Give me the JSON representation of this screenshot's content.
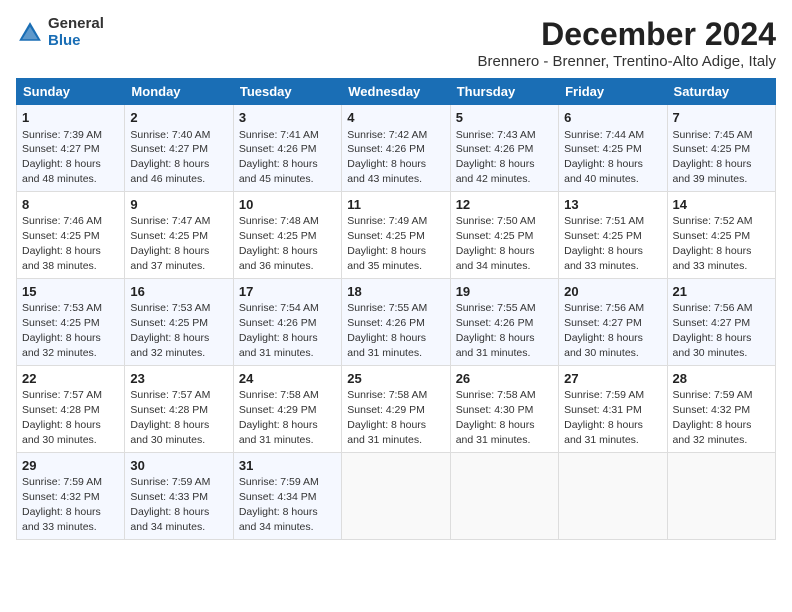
{
  "logo": {
    "general": "General",
    "blue": "Blue"
  },
  "title": "December 2024",
  "subtitle": "Brennero - Brenner, Trentino-Alto Adige, Italy",
  "days_of_week": [
    "Sunday",
    "Monday",
    "Tuesday",
    "Wednesday",
    "Thursday",
    "Friday",
    "Saturday"
  ],
  "weeks": [
    [
      {
        "day": "1",
        "sunrise": "7:39 AM",
        "sunset": "4:27 PM",
        "daylight": "8 hours and 48 minutes."
      },
      {
        "day": "2",
        "sunrise": "7:40 AM",
        "sunset": "4:27 PM",
        "daylight": "8 hours and 46 minutes."
      },
      {
        "day": "3",
        "sunrise": "7:41 AM",
        "sunset": "4:26 PM",
        "daylight": "8 hours and 45 minutes."
      },
      {
        "day": "4",
        "sunrise": "7:42 AM",
        "sunset": "4:26 PM",
        "daylight": "8 hours and 43 minutes."
      },
      {
        "day": "5",
        "sunrise": "7:43 AM",
        "sunset": "4:26 PM",
        "daylight": "8 hours and 42 minutes."
      },
      {
        "day": "6",
        "sunrise": "7:44 AM",
        "sunset": "4:25 PM",
        "daylight": "8 hours and 40 minutes."
      },
      {
        "day": "7",
        "sunrise": "7:45 AM",
        "sunset": "4:25 PM",
        "daylight": "8 hours and 39 minutes."
      }
    ],
    [
      {
        "day": "8",
        "sunrise": "7:46 AM",
        "sunset": "4:25 PM",
        "daylight": "8 hours and 38 minutes."
      },
      {
        "day": "9",
        "sunrise": "7:47 AM",
        "sunset": "4:25 PM",
        "daylight": "8 hours and 37 minutes."
      },
      {
        "day": "10",
        "sunrise": "7:48 AM",
        "sunset": "4:25 PM",
        "daylight": "8 hours and 36 minutes."
      },
      {
        "day": "11",
        "sunrise": "7:49 AM",
        "sunset": "4:25 PM",
        "daylight": "8 hours and 35 minutes."
      },
      {
        "day": "12",
        "sunrise": "7:50 AM",
        "sunset": "4:25 PM",
        "daylight": "8 hours and 34 minutes."
      },
      {
        "day": "13",
        "sunrise": "7:51 AM",
        "sunset": "4:25 PM",
        "daylight": "8 hours and 33 minutes."
      },
      {
        "day": "14",
        "sunrise": "7:52 AM",
        "sunset": "4:25 PM",
        "daylight": "8 hours and 33 minutes."
      }
    ],
    [
      {
        "day": "15",
        "sunrise": "7:53 AM",
        "sunset": "4:25 PM",
        "daylight": "8 hours and 32 minutes."
      },
      {
        "day": "16",
        "sunrise": "7:53 AM",
        "sunset": "4:25 PM",
        "daylight": "8 hours and 32 minutes."
      },
      {
        "day": "17",
        "sunrise": "7:54 AM",
        "sunset": "4:26 PM",
        "daylight": "8 hours and 31 minutes."
      },
      {
        "day": "18",
        "sunrise": "7:55 AM",
        "sunset": "4:26 PM",
        "daylight": "8 hours and 31 minutes."
      },
      {
        "day": "19",
        "sunrise": "7:55 AM",
        "sunset": "4:26 PM",
        "daylight": "8 hours and 31 minutes."
      },
      {
        "day": "20",
        "sunrise": "7:56 AM",
        "sunset": "4:27 PM",
        "daylight": "8 hours and 30 minutes."
      },
      {
        "day": "21",
        "sunrise": "7:56 AM",
        "sunset": "4:27 PM",
        "daylight": "8 hours and 30 minutes."
      }
    ],
    [
      {
        "day": "22",
        "sunrise": "7:57 AM",
        "sunset": "4:28 PM",
        "daylight": "8 hours and 30 minutes."
      },
      {
        "day": "23",
        "sunrise": "7:57 AM",
        "sunset": "4:28 PM",
        "daylight": "8 hours and 30 minutes."
      },
      {
        "day": "24",
        "sunrise": "7:58 AM",
        "sunset": "4:29 PM",
        "daylight": "8 hours and 31 minutes."
      },
      {
        "day": "25",
        "sunrise": "7:58 AM",
        "sunset": "4:29 PM",
        "daylight": "8 hours and 31 minutes."
      },
      {
        "day": "26",
        "sunrise": "7:58 AM",
        "sunset": "4:30 PM",
        "daylight": "8 hours and 31 minutes."
      },
      {
        "day": "27",
        "sunrise": "7:59 AM",
        "sunset": "4:31 PM",
        "daylight": "8 hours and 31 minutes."
      },
      {
        "day": "28",
        "sunrise": "7:59 AM",
        "sunset": "4:32 PM",
        "daylight": "8 hours and 32 minutes."
      }
    ],
    [
      {
        "day": "29",
        "sunrise": "7:59 AM",
        "sunset": "4:32 PM",
        "daylight": "8 hours and 33 minutes."
      },
      {
        "day": "30",
        "sunrise": "7:59 AM",
        "sunset": "4:33 PM",
        "daylight": "8 hours and 34 minutes."
      },
      {
        "day": "31",
        "sunrise": "7:59 AM",
        "sunset": "4:34 PM",
        "daylight": "8 hours and 34 minutes."
      },
      null,
      null,
      null,
      null
    ]
  ],
  "labels": {
    "sunrise": "Sunrise:",
    "sunset": "Sunset:",
    "daylight": "Daylight:"
  }
}
